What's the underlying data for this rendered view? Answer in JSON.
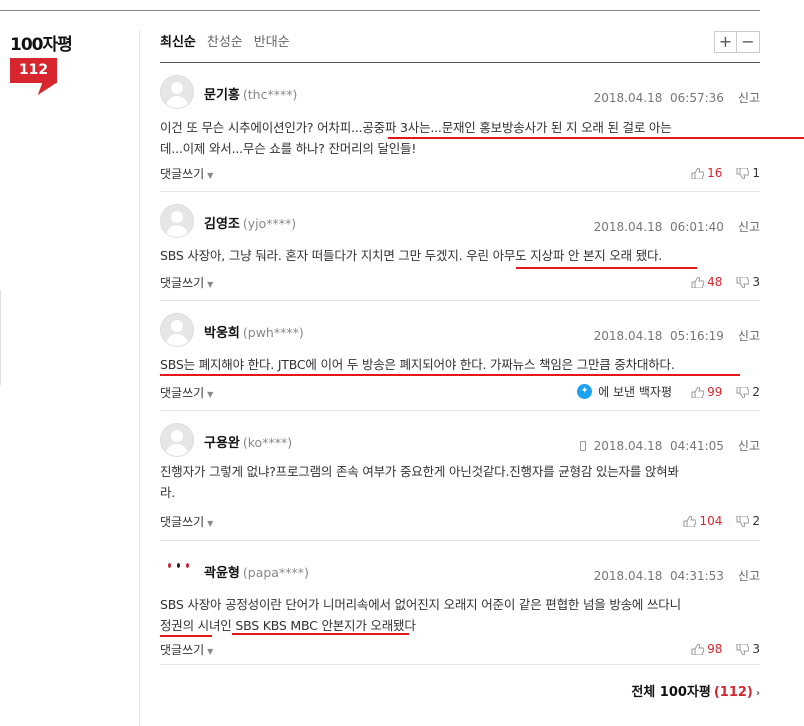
{
  "sidebar": {
    "title": "100자평",
    "count": "112"
  },
  "sort_tabs": [
    "최신순",
    "찬성순",
    "반대순"
  ],
  "zoom": {
    "plus": "+",
    "minus": "−"
  },
  "reply_label": "댓글쓰기",
  "report_label": "신고",
  "twitter_share_label": "에 보낸 백자평",
  "comments": [
    {
      "name": "문기홍",
      "uid": "(thc****)",
      "date": "2018.04.18",
      "time": "06:57:36",
      "lines": [
        "이건 또 무슨 시추에이션인가? 어차피...공중파 3사는...문재인 홍보방송사가 된 지 오래 된 걸로 아는",
        "데...이제 와서...무슨 쇼를 하나? 잔머리의 달인들!"
      ],
      "up": "16",
      "down": "1"
    },
    {
      "name": "김영조",
      "uid": "(yjo****)",
      "date": "2018.04.18",
      "time": "06:01:40",
      "lines": [
        "SBS 사장아, 그냥 둬라. 혼자 떠들다가 지치면 그만 두겠지. 우린 아무도 지상파 안 본지 오래 됐다."
      ],
      "up": "48",
      "down": "3"
    },
    {
      "name": "박웅희",
      "uid": "(pwh****)",
      "date": "2018.04.18",
      "time": "05:16:19",
      "lines": [
        "SBS는 폐지해야 한다. JTBC에 이어 두 방송은 폐지되어야 한다. 가짜뉴스 책임은 그만큼 중차대하다."
      ],
      "up": "99",
      "down": "2"
    },
    {
      "name": "구용완",
      "uid": "(ko****)",
      "date": "2018.04.18",
      "time": "04:41:05",
      "lines": [
        "진행자가 그렇게 없냐?프로그램의 존속 여부가 중요한게 아닌것같다.진행자를 균형감 있는자를 앉혀봐",
        "라."
      ],
      "up": "104",
      "down": "2"
    },
    {
      "name": "곽윤형",
      "uid": "(papa****)",
      "date": "2018.04.18",
      "time": "04:31:53",
      "lines": [
        "SBS 사장아 공정성이란 단어가 니머리속에서 없어진지 오래지 어준이 같은 편협한 넘을 방송에 쓰다니",
        "정권의 시녀인 SBS KBS MBC 안본지가 오래됐다"
      ],
      "up": "98",
      "down": "3"
    }
  ],
  "footer": {
    "label": "전체 100자평",
    "count": "(112)"
  },
  "colors": {
    "accent": "#d8262e",
    "underline": "#e4171b",
    "twitter": "#1da1f2"
  }
}
